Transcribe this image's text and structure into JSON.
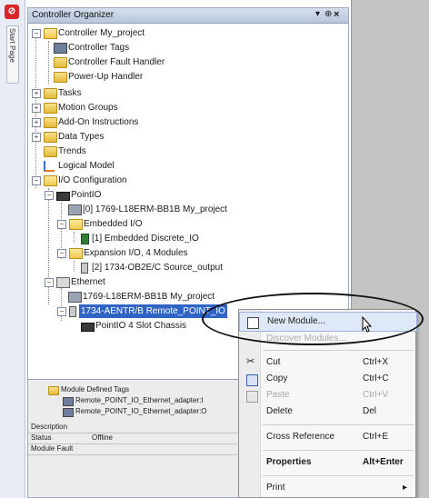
{
  "side_tab": {
    "label": "Start Page"
  },
  "panel": {
    "title": "Controller Organizer",
    "pin_symbol": "▾",
    "pin2_symbol": "⊕",
    "close_symbol": "×"
  },
  "tree": {
    "controller": "Controller My_project",
    "controller_tags": "Controller Tags",
    "fault_handler": "Controller Fault Handler",
    "powerup_handler": "Power-Up Handler",
    "tasks": "Tasks",
    "motion_groups": "Motion Groups",
    "aoi": "Add-On Instructions",
    "data_types": "Data Types",
    "trends": "Trends",
    "logical_model": "Logical Model",
    "io_config": "I/O Configuration",
    "pointio": "PointIO",
    "plc_slot0": "[0] 1769-L18ERM-BB1B My_project",
    "embedded_io": "Embedded I/O",
    "embedded_discrete": "[1] Embedded Discrete_IO",
    "expansion_io": "Expansion I/O, 4 Modules",
    "source_output": "[2] 1734-OB2E/C Source_output",
    "ethernet": "Ethernet",
    "eth_plc": "1769-L18ERM-BB1B My_project",
    "aentr": "1734-AENTR/B Remote_POINT_IO",
    "chassis": "PointIO 4 Slot Chassis"
  },
  "detail": {
    "header": "Module Defined Tags",
    "tag1": "Remote_POINT_IO_Ethernet_adapter:I",
    "tag2": "Remote_POINT_IO_Ethernet_adapter:O",
    "rows": [
      {
        "label": "Description",
        "value": ""
      },
      {
        "label": "Status",
        "value": "Offline"
      },
      {
        "label": "Module Fault",
        "value": ""
      }
    ]
  },
  "context_menu": {
    "new_module": "New Module...",
    "discover_modules": "Discover Modules...",
    "cut": "Cut",
    "cut_shortcut": "Ctrl+X",
    "copy": "Copy",
    "copy_shortcut": "Ctrl+C",
    "paste": "Paste",
    "paste_shortcut": "Ctrl+V",
    "delete": "Delete",
    "delete_shortcut": "Del",
    "cross_reference": "Cross Reference",
    "cross_reference_shortcut": "Ctrl+E",
    "properties": "Properties",
    "properties_shortcut": "Alt+Enter",
    "print": "Print",
    "print_arrow": "▸"
  },
  "colors": {
    "selection": "#2f63c5",
    "menu_highlight": "#dfe8f6",
    "app_red": "#d8262a"
  }
}
